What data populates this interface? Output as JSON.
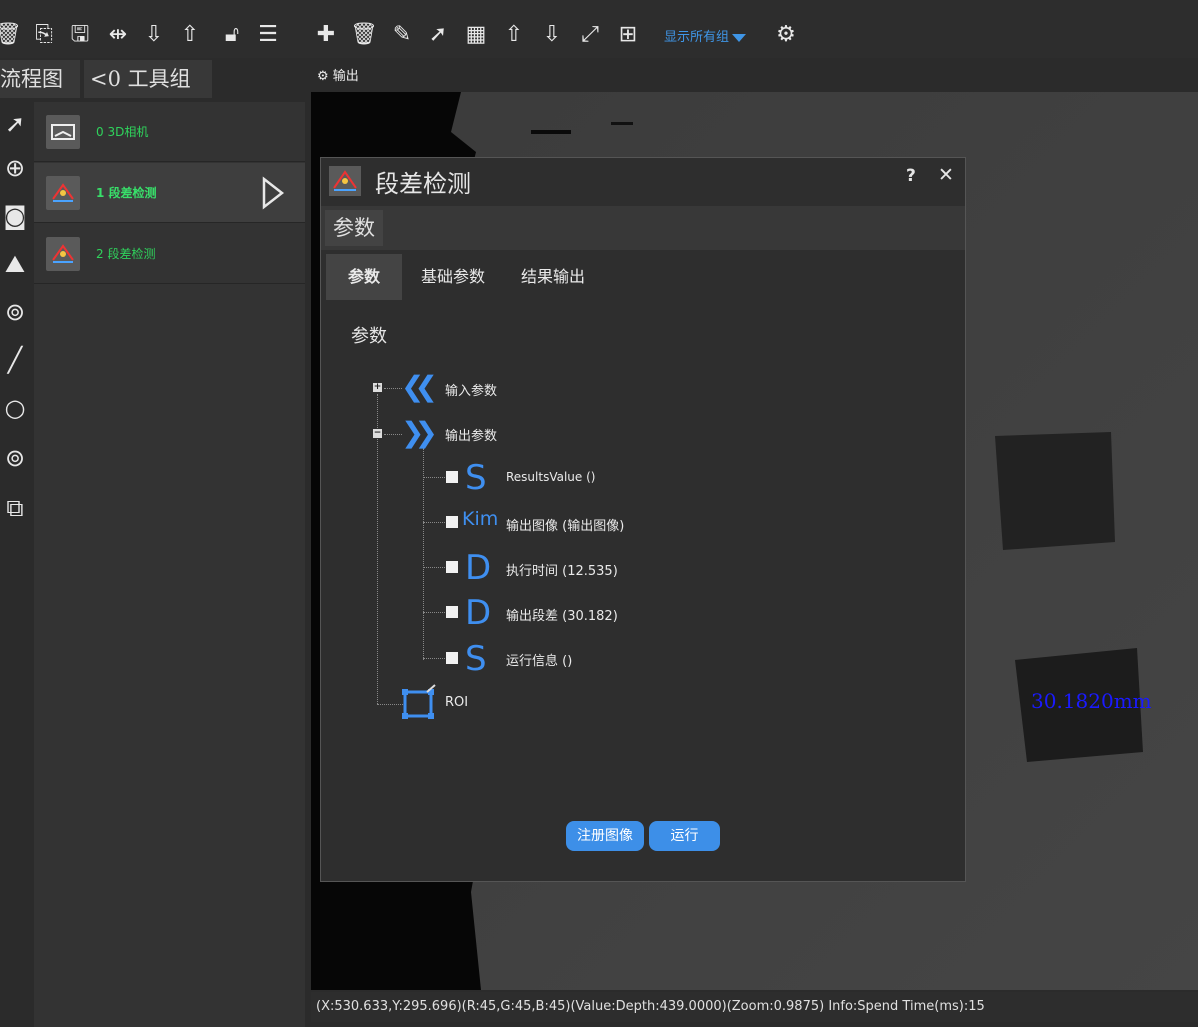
{
  "toolbar": {
    "show_groups_label": "显示所有组",
    "left_icons": [
      "delete-icon",
      "copy-icon",
      "save-icon",
      "split-icon",
      "arrow-down-icon",
      "arrow-up-icon",
      "unlock-icon",
      "menu-icon"
    ],
    "right_icons": [
      "add-icon",
      "trash-icon",
      "brush-icon",
      "pointer-icon",
      "calculator-icon",
      "arrow-up-icon",
      "arrow-down-icon",
      "resize-icon",
      "grid-icon"
    ]
  },
  "left_tabs": {
    "flow": "流程图",
    "group": "<0 工具组"
  },
  "flow_items": [
    {
      "label": "0 3D相机"
    },
    {
      "label": "1 段差检测"
    },
    {
      "label": "2 段差检测"
    }
  ],
  "output_header": "输出",
  "dialog": {
    "title": "段差检测",
    "help": "?",
    "close": "✕",
    "param_chip": "参数",
    "tabs": [
      "参数",
      "基础参数",
      "结果输出"
    ],
    "section_title": "参数",
    "tree": {
      "input_params": "输入参数",
      "output_params": "输出参数",
      "outputs": [
        {
          "glyph": "S",
          "label": "ResultsValue ()"
        },
        {
          "glyph": "Kim",
          "label": "输出图像 (输出图像)"
        },
        {
          "glyph": "D",
          "label": "执行时间 (12.535)"
        },
        {
          "glyph": "D",
          "label": "输出段差 (30.182)"
        },
        {
          "glyph": "S",
          "label": "运行信息 ()"
        }
      ],
      "roi": "ROI"
    },
    "buttons": {
      "register": "注册图像",
      "run": "运行"
    }
  },
  "canvas": {
    "measure_label": "30.1820mm",
    "measure_color": "#1a1aff"
  },
  "status": "(X:530.633,Y:295.696)(R:45,G:45,B:45)(Value:Depth:439.0000)(Zoom:0.9875)  Info:Spend Time(ms):15"
}
